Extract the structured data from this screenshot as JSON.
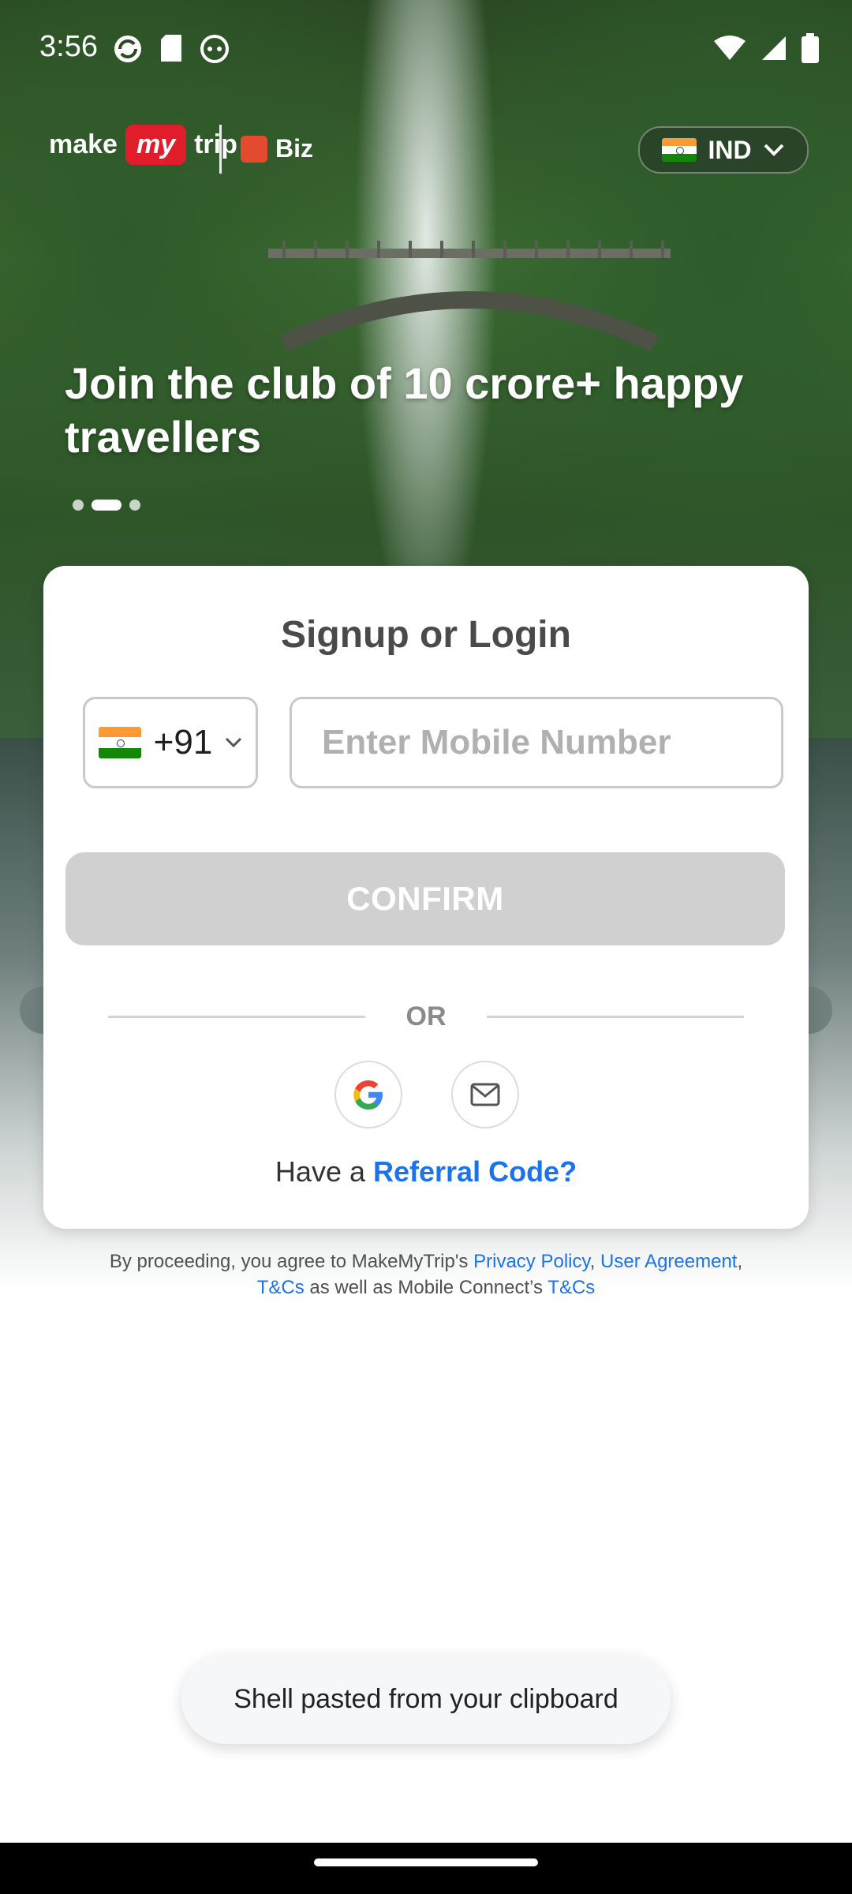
{
  "status_bar": {
    "time": "3:56"
  },
  "header": {
    "logo": {
      "make": "make",
      "my": "my",
      "trip": "trip"
    },
    "biz_label": "Biz",
    "country_label": "IND"
  },
  "hero": {
    "headline": "Join the club of 10 crore+ happy travellers",
    "carousel": {
      "count": 3,
      "active_index": 1
    }
  },
  "card": {
    "title": "Signup or Login",
    "country_code": "+91",
    "mobile_placeholder": "Enter Mobile Number",
    "confirm_label": "CONFIRM",
    "or_label": "OR",
    "referral_prefix": "Have a ",
    "referral_link": "Referral Code?"
  },
  "legal": {
    "prefix": "By proceeding, you agree to MakeMyTrip's ",
    "privacy": "Privacy Policy",
    "comma1": ", ",
    "user_agreement": "User Agreement",
    "comma2": ",",
    "tncs1": "T&Cs",
    "middle": " as well as Mobile Connect’s ",
    "tncs2": "T&Cs"
  },
  "toast": {
    "message": "Shell pasted from your clipboard"
  },
  "colors": {
    "link": "#1a73e8",
    "confirm_disabled": "#d0d0d0",
    "brand_red": "#e11d2c"
  },
  "icons": [
    "sync-icon",
    "sd-card-icon",
    "robot-icon",
    "wifi-icon",
    "signal-icon",
    "battery-icon",
    "chevron-down-icon",
    "google-icon",
    "mail-icon"
  ]
}
